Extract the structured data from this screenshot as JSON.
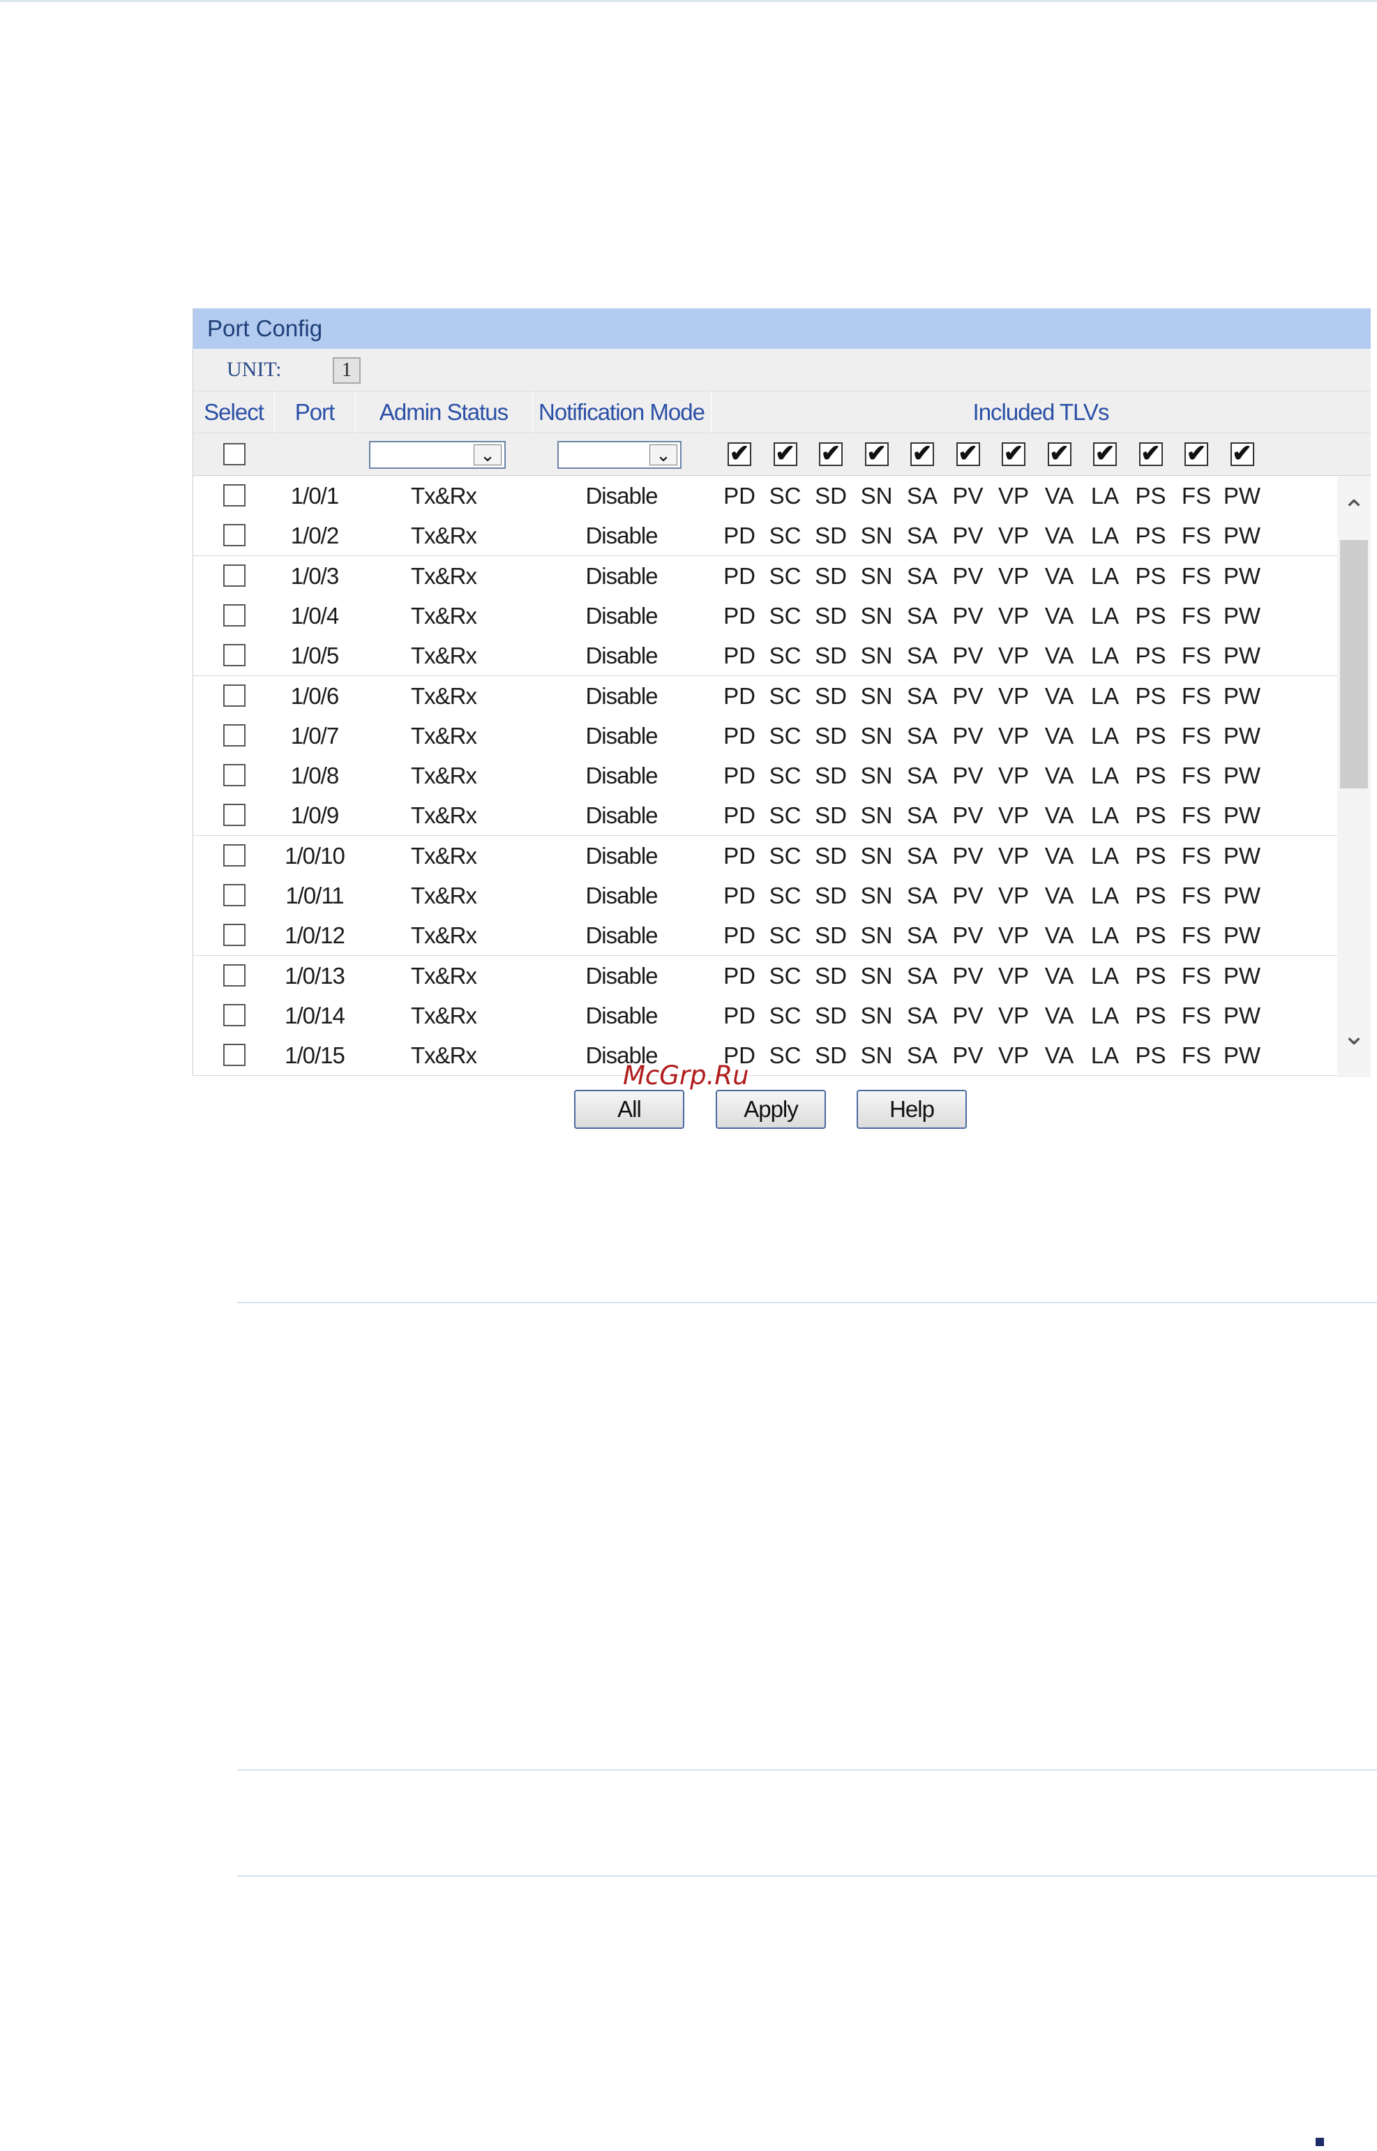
{
  "panel": {
    "title": "Port Config",
    "unit_label": "UNIT:",
    "unit_value": "1"
  },
  "headers": {
    "select": "Select",
    "port": "Port",
    "admin_status": "Admin Status",
    "notification_mode": "Notification Mode",
    "included_tlvs": "Included TLVs"
  },
  "filters": {
    "admin_status_value": "",
    "notification_mode_value": "",
    "tlv_all_checked": true
  },
  "tlvs": [
    "PD",
    "SC",
    "SD",
    "SN",
    "SA",
    "PV",
    "VP",
    "VA",
    "LA",
    "PS",
    "FS",
    "PW"
  ],
  "rows": [
    {
      "port": "1/0/1",
      "admin": "Tx&Rx",
      "notify": "Disable"
    },
    {
      "port": "1/0/2",
      "admin": "Tx&Rx",
      "notify": "Disable"
    },
    {
      "port": "1/0/3",
      "admin": "Tx&Rx",
      "notify": "Disable"
    },
    {
      "port": "1/0/4",
      "admin": "Tx&Rx",
      "notify": "Disable"
    },
    {
      "port": "1/0/5",
      "admin": "Tx&Rx",
      "notify": "Disable"
    },
    {
      "port": "1/0/6",
      "admin": "Tx&Rx",
      "notify": "Disable"
    },
    {
      "port": "1/0/7",
      "admin": "Tx&Rx",
      "notify": "Disable"
    },
    {
      "port": "1/0/8",
      "admin": "Tx&Rx",
      "notify": "Disable"
    },
    {
      "port": "1/0/9",
      "admin": "Tx&Rx",
      "notify": "Disable"
    },
    {
      "port": "1/0/10",
      "admin": "Tx&Rx",
      "notify": "Disable"
    },
    {
      "port": "1/0/11",
      "admin": "Tx&Rx",
      "notify": "Disable"
    },
    {
      "port": "1/0/12",
      "admin": "Tx&Rx",
      "notify": "Disable"
    },
    {
      "port": "1/0/13",
      "admin": "Tx&Rx",
      "notify": "Disable"
    },
    {
      "port": "1/0/14",
      "admin": "Tx&Rx",
      "notify": "Disable"
    },
    {
      "port": "1/0/15",
      "admin": "Tx&Rx",
      "notify": "Disable"
    }
  ],
  "buttons": {
    "all": "All",
    "apply": "Apply",
    "help": "Help"
  },
  "watermark": "McGrp.Ru",
  "colors": {
    "title_bar": "#b3cbef",
    "header_text": "#2a4fa6",
    "watermark": "#b01c1c"
  }
}
